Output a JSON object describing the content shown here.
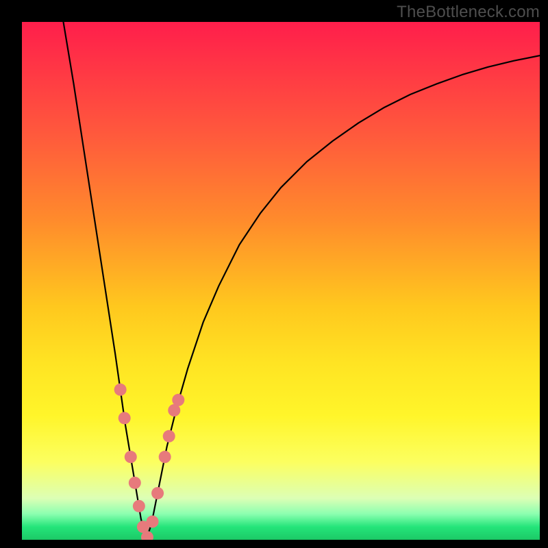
{
  "watermark": "TheBottleneck.com",
  "colors": {
    "curve": "#000000",
    "background_frame": "#000000",
    "marker_fill": "#e77a7c",
    "marker_stroke": "#e77a7c",
    "gradient_top": "#ff1e4b",
    "gradient_bottom": "#1cc966"
  },
  "chart_data": {
    "type": "line",
    "title": "",
    "xlabel": "",
    "ylabel": "",
    "xlim": [
      0,
      100
    ],
    "ylim": [
      0,
      100
    ],
    "grid": false,
    "legend": false,
    "description": "V-shaped bottleneck curve with minimum near x≈24; overlaid salmon markers clustered around the trough.",
    "series": [
      {
        "name": "curve",
        "x": [
          8,
          10,
          12,
          14,
          16,
          18,
          20,
          21,
          22,
          23,
          24,
          25,
          26,
          27,
          28,
          30,
          32,
          35,
          38,
          42,
          46,
          50,
          55,
          60,
          65,
          70,
          75,
          80,
          85,
          90,
          95,
          100
        ],
        "y": [
          100,
          88,
          75,
          62,
          49,
          36,
          22,
          16,
          10,
          4,
          0,
          3,
          8,
          13,
          18,
          26,
          33,
          42,
          49,
          57,
          63,
          68,
          73,
          77,
          80.5,
          83.5,
          86,
          88,
          89.8,
          91.3,
          92.5,
          93.5
        ]
      },
      {
        "name": "markers",
        "x": [
          19.0,
          19.8,
          21.0,
          21.8,
          22.6,
          23.4,
          24.2,
          25.2,
          26.2,
          27.6,
          28.4,
          29.4,
          30.2
        ],
        "y": [
          29,
          23.5,
          16,
          11,
          6.5,
          2.5,
          0.5,
          3.5,
          9,
          16,
          20,
          25,
          27
        ]
      }
    ]
  }
}
